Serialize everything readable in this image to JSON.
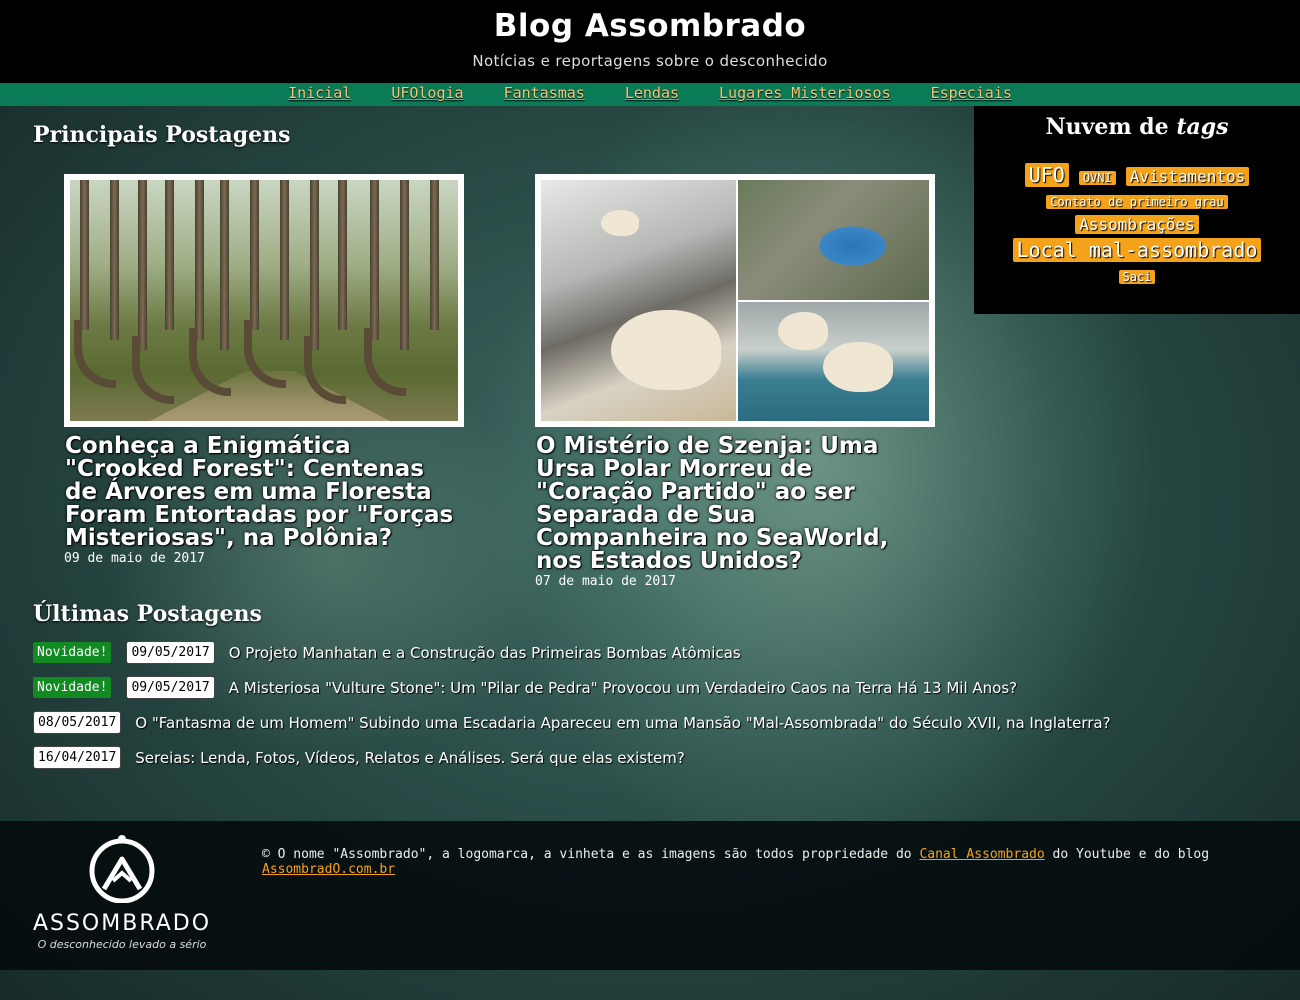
{
  "header": {
    "title": "Blog Assombrado",
    "subtitle": "Notícias e reportagens sobre o desconhecido"
  },
  "nav": {
    "items": [
      "Inicial",
      "UFOlogia",
      "Fantasmas",
      "Lendas",
      "Lugares Misteriosos",
      "Especiais"
    ]
  },
  "featured": {
    "heading": "Principais Postagens",
    "posts": [
      {
        "title": "Conheça a Enigmática \"Crooked Forest\": Centenas de Árvores em uma Floresta Foram Entortadas por \"Forças Misteriosas\", na Polônia?",
        "date": "09 de maio de 2017",
        "image": "crooked-forest-photo"
      },
      {
        "title": "O Mistério de Szenja: Uma Ursa Polar Morreu de \"Coração Partido\" ao ser Separada de Sua Companheira no SeaWorld, nos Estados Unidos?",
        "date": "07 de maio de 2017",
        "image": "polar-bear-collage"
      }
    ]
  },
  "tag_cloud": {
    "title_prefix": "Nuvem de",
    "title_emph": "tags",
    "tags": [
      {
        "label": "UFO",
        "size": "l"
      },
      {
        "label": "OVNI",
        "size": "s"
      },
      {
        "label": "Avistamentos",
        "size": "m"
      },
      {
        "label": "Contato de primeiro grau",
        "size": "s"
      },
      {
        "label": "Assombrações",
        "size": "m"
      },
      {
        "label": "Local mal-assombrado",
        "size": "xl"
      },
      {
        "label": "Saci",
        "size": "s"
      }
    ],
    "tag_color": "#f5a21b"
  },
  "latest": {
    "heading": "Últimas Postagens",
    "new_label": "Novidade!",
    "posts": [
      {
        "new": true,
        "date": "09/05/2017",
        "title": "O Projeto Manhatan e a Construção das Primeiras Bombas Atômicas"
      },
      {
        "new": true,
        "date": "09/05/2017",
        "title": "A Misteriosa \"Vulture Stone\": Um \"Pilar de Pedra\" Provocou um Verdadeiro Caos na Terra Há 13 Mil Anos?"
      },
      {
        "new": false,
        "date": "08/05/2017",
        "title": "O \"Fantasma de um Homem\" Subindo uma Escadaria Apareceu em uma Mansão \"Mal-Assombrada\" do Século XVII, na Inglaterra?"
      },
      {
        "new": false,
        "date": "16/04/2017",
        "title": "Sereias: Lenda, Fotos, Vídeos, Relatos e Análises. Será que elas existem?"
      }
    ]
  },
  "footer": {
    "logo_word": "ASSOMBRADO",
    "logo_tagline": "O desconhecido levado a sério",
    "text_before": "© O nome \"Assombrado\", a logomarca, a vinheta e as imagens são todos propriedade do ",
    "link1": "Canal Assombrado",
    "text_middle": " do Youtube e do blog ",
    "link2": "AssombradO.com.br"
  },
  "colors": {
    "nav_bg": "#0b7a57",
    "nav_link": "#f5c878",
    "new_badge": "#128a22",
    "accent": "#f5a21b"
  }
}
